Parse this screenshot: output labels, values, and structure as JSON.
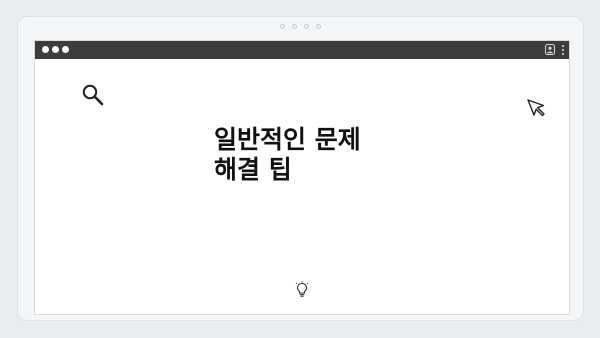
{
  "window": {
    "traffic_lights": [
      "close",
      "minimize",
      "maximize"
    ],
    "toolbar_icons": [
      "profile-icon",
      "menu-dots-icon"
    ]
  },
  "content": {
    "headline_line1": "일반적인 문제",
    "headline_line2": "해결 팁",
    "icons": [
      "search-icon",
      "cursor-icon",
      "lightbulb-icon"
    ]
  },
  "pager": {
    "count": 4
  },
  "colors": {
    "titlebar": "#3c3c3c",
    "frame_bg": "#f3f5f7",
    "page_bg": "#e9ecef",
    "content_bg": "#ffffff",
    "text": "#111111"
  }
}
